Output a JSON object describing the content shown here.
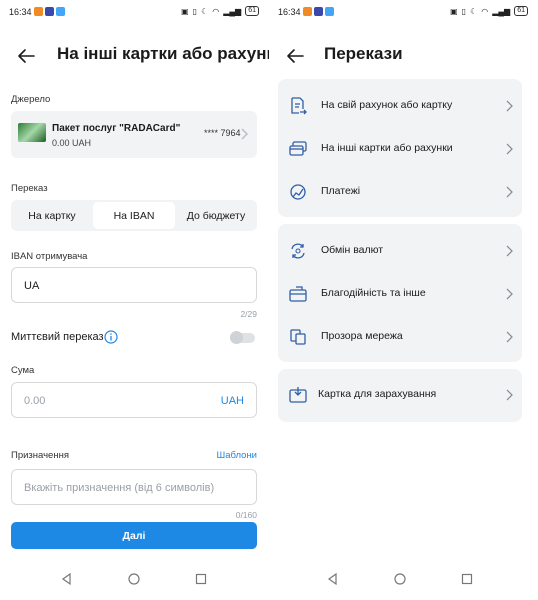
{
  "status_bar": {
    "time": "16:34",
    "battery": "61"
  },
  "left": {
    "title": "На інші картки або рахунки",
    "source_label": "Джерело",
    "card": {
      "name": "Пакет послуг \"RADACard\"",
      "balance": "0.00 UAH",
      "number": "**** 7964"
    },
    "transfer_label": "Переказ",
    "tabs": [
      {
        "label": "На картку",
        "active": false
      },
      {
        "label": "На IBAN",
        "active": true
      },
      {
        "label": "До бюджету",
        "active": false
      }
    ],
    "iban_label": "IBAN отримувача",
    "iban_value": "UA",
    "iban_counter": "2/29",
    "instant_label": "Миттєвий переказ",
    "amount_label": "Сума",
    "amount_placeholder": "0.00",
    "currency": "UAH",
    "purpose_label": "Призначення",
    "templates_link": "Шаблони",
    "purpose_placeholder": "Вкажіть призначення (від 6 символів)",
    "purpose_counter": "0/160",
    "next_button": "Далі"
  },
  "right": {
    "title": "Перекази",
    "groups": [
      {
        "items": [
          {
            "label": "На свій рахунок або картку",
            "icon": "document-arrow-icon"
          },
          {
            "label": "На інші картки або рахунки",
            "icon": "cards-icon"
          },
          {
            "label": "Платежі",
            "icon": "payments-icon"
          }
        ]
      },
      {
        "items": [
          {
            "label": "Обмін валют",
            "icon": "currency-exchange-icon"
          },
          {
            "label": "Благодійність та інше",
            "icon": "charity-icon"
          },
          {
            "label": "Прозора мережа",
            "icon": "network-icon"
          }
        ]
      },
      {
        "items": [
          {
            "label": "Картка для зарахування",
            "icon": "card-download-icon"
          }
        ]
      }
    ]
  },
  "colors": {
    "accent": "#1e88e5",
    "surface": "#f2f3f5",
    "icon": "#2f5fa8"
  }
}
